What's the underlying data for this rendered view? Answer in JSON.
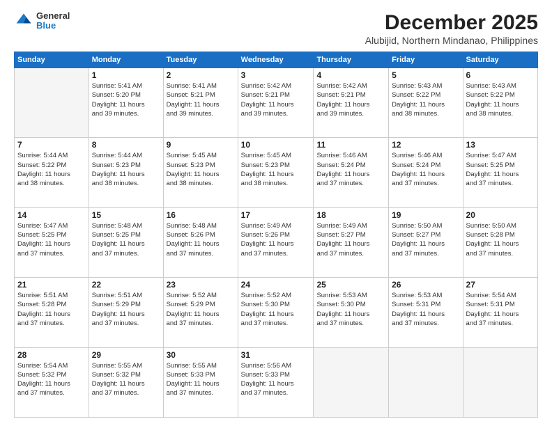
{
  "logo": {
    "general": "General",
    "blue": "Blue"
  },
  "title": "December 2025",
  "location": "Alubijid, Northern Mindanao, Philippines",
  "days_of_week": [
    "Sunday",
    "Monday",
    "Tuesday",
    "Wednesday",
    "Thursday",
    "Friday",
    "Saturday"
  ],
  "weeks": [
    [
      {
        "day": "",
        "info": ""
      },
      {
        "day": "1",
        "info": "Sunrise: 5:41 AM\nSunset: 5:20 PM\nDaylight: 11 hours\nand 39 minutes."
      },
      {
        "day": "2",
        "info": "Sunrise: 5:41 AM\nSunset: 5:21 PM\nDaylight: 11 hours\nand 39 minutes."
      },
      {
        "day": "3",
        "info": "Sunrise: 5:42 AM\nSunset: 5:21 PM\nDaylight: 11 hours\nand 39 minutes."
      },
      {
        "day": "4",
        "info": "Sunrise: 5:42 AM\nSunset: 5:21 PM\nDaylight: 11 hours\nand 39 minutes."
      },
      {
        "day": "5",
        "info": "Sunrise: 5:43 AM\nSunset: 5:22 PM\nDaylight: 11 hours\nand 38 minutes."
      },
      {
        "day": "6",
        "info": "Sunrise: 5:43 AM\nSunset: 5:22 PM\nDaylight: 11 hours\nand 38 minutes."
      }
    ],
    [
      {
        "day": "7",
        "info": "Sunrise: 5:44 AM\nSunset: 5:22 PM\nDaylight: 11 hours\nand 38 minutes."
      },
      {
        "day": "8",
        "info": "Sunrise: 5:44 AM\nSunset: 5:23 PM\nDaylight: 11 hours\nand 38 minutes."
      },
      {
        "day": "9",
        "info": "Sunrise: 5:45 AM\nSunset: 5:23 PM\nDaylight: 11 hours\nand 38 minutes."
      },
      {
        "day": "10",
        "info": "Sunrise: 5:45 AM\nSunset: 5:23 PM\nDaylight: 11 hours\nand 38 minutes."
      },
      {
        "day": "11",
        "info": "Sunrise: 5:46 AM\nSunset: 5:24 PM\nDaylight: 11 hours\nand 37 minutes."
      },
      {
        "day": "12",
        "info": "Sunrise: 5:46 AM\nSunset: 5:24 PM\nDaylight: 11 hours\nand 37 minutes."
      },
      {
        "day": "13",
        "info": "Sunrise: 5:47 AM\nSunset: 5:25 PM\nDaylight: 11 hours\nand 37 minutes."
      }
    ],
    [
      {
        "day": "14",
        "info": "Sunrise: 5:47 AM\nSunset: 5:25 PM\nDaylight: 11 hours\nand 37 minutes."
      },
      {
        "day": "15",
        "info": "Sunrise: 5:48 AM\nSunset: 5:25 PM\nDaylight: 11 hours\nand 37 minutes."
      },
      {
        "day": "16",
        "info": "Sunrise: 5:48 AM\nSunset: 5:26 PM\nDaylight: 11 hours\nand 37 minutes."
      },
      {
        "day": "17",
        "info": "Sunrise: 5:49 AM\nSunset: 5:26 PM\nDaylight: 11 hours\nand 37 minutes."
      },
      {
        "day": "18",
        "info": "Sunrise: 5:49 AM\nSunset: 5:27 PM\nDaylight: 11 hours\nand 37 minutes."
      },
      {
        "day": "19",
        "info": "Sunrise: 5:50 AM\nSunset: 5:27 PM\nDaylight: 11 hours\nand 37 minutes."
      },
      {
        "day": "20",
        "info": "Sunrise: 5:50 AM\nSunset: 5:28 PM\nDaylight: 11 hours\nand 37 minutes."
      }
    ],
    [
      {
        "day": "21",
        "info": "Sunrise: 5:51 AM\nSunset: 5:28 PM\nDaylight: 11 hours\nand 37 minutes."
      },
      {
        "day": "22",
        "info": "Sunrise: 5:51 AM\nSunset: 5:29 PM\nDaylight: 11 hours\nand 37 minutes."
      },
      {
        "day": "23",
        "info": "Sunrise: 5:52 AM\nSunset: 5:29 PM\nDaylight: 11 hours\nand 37 minutes."
      },
      {
        "day": "24",
        "info": "Sunrise: 5:52 AM\nSunset: 5:30 PM\nDaylight: 11 hours\nand 37 minutes."
      },
      {
        "day": "25",
        "info": "Sunrise: 5:53 AM\nSunset: 5:30 PM\nDaylight: 11 hours\nand 37 minutes."
      },
      {
        "day": "26",
        "info": "Sunrise: 5:53 AM\nSunset: 5:31 PM\nDaylight: 11 hours\nand 37 minutes."
      },
      {
        "day": "27",
        "info": "Sunrise: 5:54 AM\nSunset: 5:31 PM\nDaylight: 11 hours\nand 37 minutes."
      }
    ],
    [
      {
        "day": "28",
        "info": "Sunrise: 5:54 AM\nSunset: 5:32 PM\nDaylight: 11 hours\nand 37 minutes."
      },
      {
        "day": "29",
        "info": "Sunrise: 5:55 AM\nSunset: 5:32 PM\nDaylight: 11 hours\nand 37 minutes."
      },
      {
        "day": "30",
        "info": "Sunrise: 5:55 AM\nSunset: 5:33 PM\nDaylight: 11 hours\nand 37 minutes."
      },
      {
        "day": "31",
        "info": "Sunrise: 5:56 AM\nSunset: 5:33 PM\nDaylight: 11 hours\nand 37 minutes."
      },
      {
        "day": "",
        "info": ""
      },
      {
        "day": "",
        "info": ""
      },
      {
        "day": "",
        "info": ""
      }
    ]
  ]
}
